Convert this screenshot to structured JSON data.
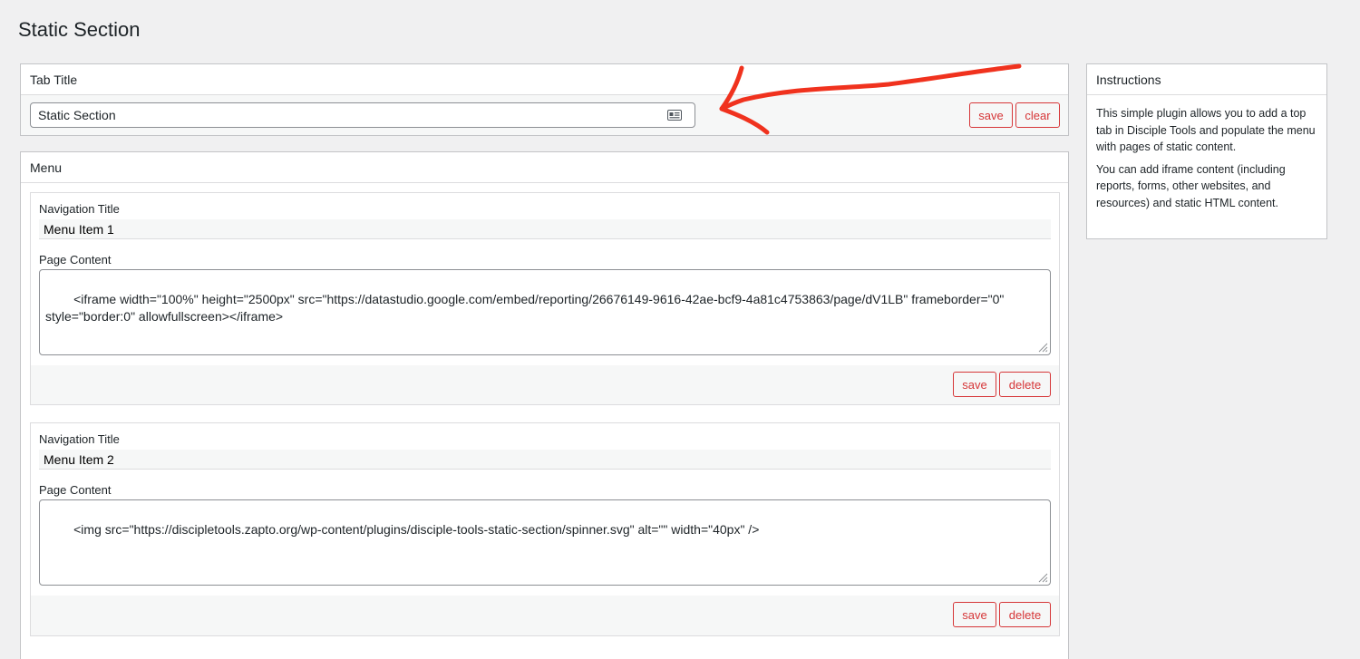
{
  "page": {
    "title": "Static Section"
  },
  "tab_title": {
    "header": "Tab Title",
    "input_value": "Static Section",
    "save_label": "save",
    "clear_label": "clear"
  },
  "menu": {
    "header": "Menu",
    "items": [
      {
        "nav_label": "Navigation Title",
        "nav_value": "Menu Item 1",
        "content_label": "Page Content",
        "content_value": "<iframe width=\"100%\" height=\"2500px\" src=\"https://datastudio.google.com/embed/reporting/26676149-9616-42ae-bcf9-4a81c4753863/page/dV1LB\" frameborder=\"0\"\nstyle=\"border:0\" allowfullscreen></iframe>",
        "save_label": "save",
        "delete_label": "delete"
      },
      {
        "nav_label": "Navigation Title",
        "nav_value": "Menu Item 2",
        "content_label": "Page Content",
        "content_value": "<img src=\"https://discipletools.zapto.org/wp-content/plugins/disciple-tools-static-section/spinner.svg\" alt=\"\" width=\"40px\" />",
        "save_label": "save",
        "delete_label": "delete"
      }
    ]
  },
  "instructions": {
    "header": "Instructions",
    "paragraphs": [
      "This simple plugin allows you to add a top tab in Disciple Tools and populate the menu with pages of static content.",
      "You can add iframe content (including reports, forms, other websites, and resources) and static HTML content."
    ]
  },
  "colors": {
    "accent": "#d63638",
    "annotation_arrow": "#f0321e",
    "background": "#f0f0f1"
  },
  "icons": {
    "autofill": "contact-card-icon",
    "resize": "resize-grip-icon"
  }
}
